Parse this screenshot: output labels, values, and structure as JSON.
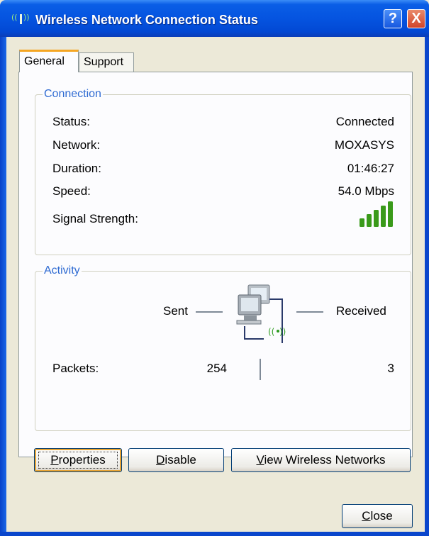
{
  "window": {
    "title": "Wireless Network Connection Status",
    "help_glyph": "?",
    "close_glyph": "X"
  },
  "tabs": [
    {
      "label": "General",
      "selected": true
    },
    {
      "label": "Support",
      "selected": false
    }
  ],
  "connection": {
    "group_label": "Connection",
    "status_label": "Status:",
    "status_value": "Connected",
    "network_label": "Network:",
    "network_value": "MOXASYS",
    "duration_label": "Duration:",
    "duration_value": "01:46:27",
    "speed_label": "Speed:",
    "speed_value": "54.0 Mbps",
    "signal_label": "Signal Strength:",
    "signal_bars": 5
  },
  "activity": {
    "group_label": "Activity",
    "sent_label": "Sent",
    "received_label": "Received",
    "packets_label": "Packets:",
    "packets_sent": "254",
    "packets_received": "3"
  },
  "buttons": {
    "properties_first": "P",
    "properties_rest": "roperties",
    "disable_first": "D",
    "disable_rest": "isable",
    "view_first": "V",
    "view_rest": "iew Wireless Networks",
    "close_first": "C",
    "close_rest": "lose"
  },
  "colors": {
    "titlebar": "#0554e0",
    "group_label": "#2f6bd2",
    "signal_green": "#3a9a1a",
    "tab_highlight": "#f5a623"
  }
}
